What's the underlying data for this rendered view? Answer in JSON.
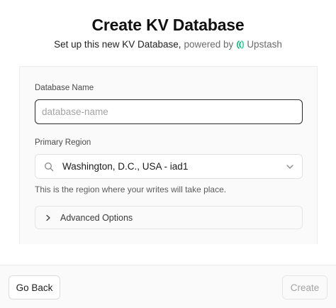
{
  "header": {
    "title": "Create KV Database",
    "subtitle_main": "Set up this new KV Database,",
    "subtitle_powered": "powered by",
    "brand_name": "Upstash",
    "brand_icon": "upstash-logo-icon",
    "brand_color": "#10b981"
  },
  "form": {
    "name_label": "Database Name",
    "name_value": "",
    "name_placeholder": "database-name",
    "region_label": "Primary Region",
    "region_value": "Washington, D.C., USA - iad1",
    "region_help": "This is the region where your writes will take place.",
    "advanced_label": "Advanced Options"
  },
  "footer": {
    "back_label": "Go Back",
    "create_label": "Create"
  }
}
